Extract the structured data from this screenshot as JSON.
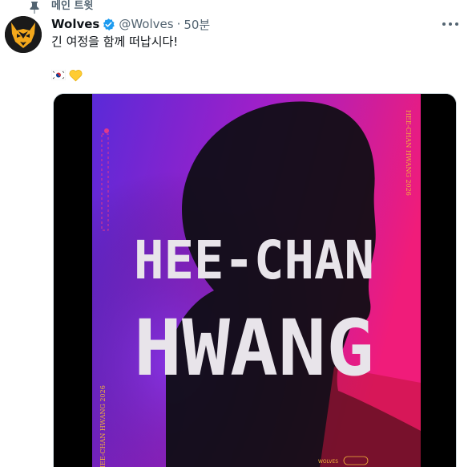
{
  "pinned": {
    "label": "메인 트윗",
    "icon": "pin-icon"
  },
  "tweet": {
    "display_name": "Wolves",
    "handle": "@Wolves",
    "separator": "·",
    "time": "50분",
    "text": "긴 여정을 함께 떠납시다!",
    "emojis": [
      "kr-flag-icon",
      "yellow-heart-icon"
    ],
    "verified_icon": "verified-badge-icon",
    "more_icon": "more-options-icon"
  },
  "poster": {
    "title_line1": "HEE-CHAN",
    "title_line2": "HWANG",
    "side_text_right": "HEE-CHAN HWANG 2026",
    "side_text_left": "HEE-CHAN HWANG 2026",
    "footer_left": "WOLVES",
    "accent_colors": {
      "purple": "#6b2fd9",
      "magenta": "#e01a8a",
      "red": "#d81c4a"
    }
  },
  "colors": {
    "text_primary": "#0f1419",
    "text_secondary": "#536471",
    "verified": "#1d9bf0"
  }
}
